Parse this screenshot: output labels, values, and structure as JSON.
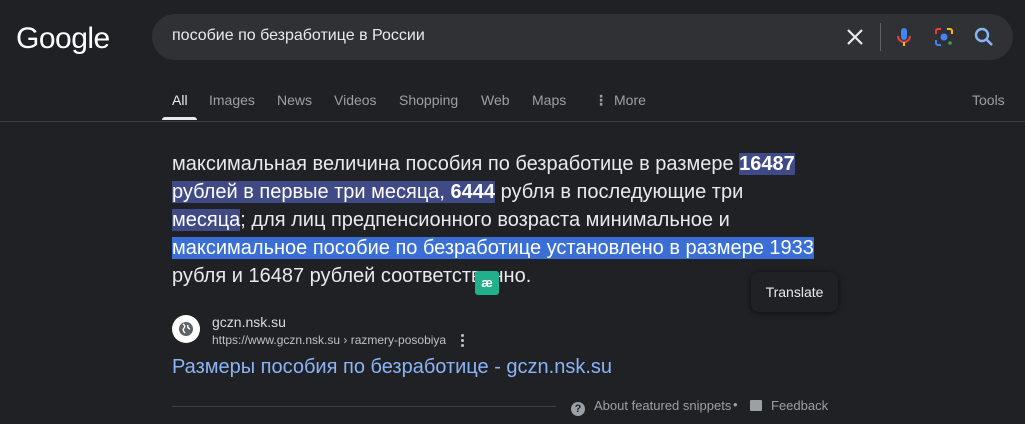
{
  "header": {
    "logo": "Google",
    "search": {
      "value": "пособие по безработице в России",
      "icons": [
        "close-icon",
        "microphone-icon",
        "lens-icon",
        "search-icon"
      ]
    }
  },
  "tabs": {
    "items": [
      "All",
      "Images",
      "News",
      "Videos",
      "Shopping",
      "Web",
      "Maps",
      "More"
    ],
    "active": "All",
    "tools": "Tools"
  },
  "snippet": {
    "t1": "максимальная величина пособия по безработице в размере ",
    "t2": "16487",
    "t3": "рублей в первые три месяца, ",
    "t4": "6444",
    "t5": " рубля в последующие три",
    "t6": "месяца",
    "t7": "; для лиц предпенсионного возраста минимальное и",
    "t8": "максимальное пособие по безработице установлено в размере 1933",
    "t9": "рубля и 16487 рублей соответственно."
  },
  "overlay": {
    "translate_label": "Translate",
    "float_icon": "translate-extension-icon"
  },
  "source": {
    "name": "gczn.nsk.su",
    "url": "https://www.gczn.nsk.su › razmery-posobiya",
    "title": "Размеры пособия по безработице - gczn.nsk.su"
  },
  "footer": {
    "about": "About featured snippets",
    "separator": "•",
    "feedback": "Feedback"
  },
  "colors": {
    "background": "#202124",
    "link": "#8ab4f8",
    "highlight_dark": "#3f4a87",
    "highlight_blue": "#3a6fd6"
  }
}
